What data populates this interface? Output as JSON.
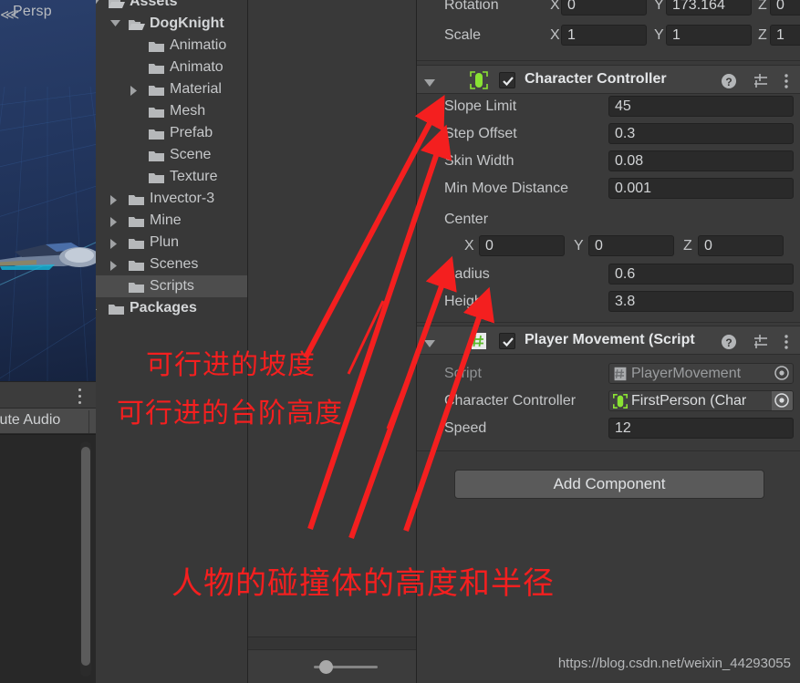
{
  "scene_view": {
    "camera_label": "Persp",
    "persp_icon": "perspective-icon",
    "kebab_icon": "more-options-icon"
  },
  "audio_bar": {
    "mute_audio_label": "lute Audio"
  },
  "project_tree": [
    {
      "label": "Assets",
      "indent": 14,
      "twisty": "down",
      "folder": "folder-open-icon",
      "bold": true,
      "selected": false
    },
    {
      "label": "DogKnight",
      "indent": 36,
      "twisty": "down",
      "folder": "folder-open-icon",
      "bold": true,
      "selected": false
    },
    {
      "label": "Animatio",
      "indent": 58,
      "twisty": "none",
      "folder": "folder-icon",
      "bold": false,
      "selected": false
    },
    {
      "label": "Animato",
      "indent": 58,
      "twisty": "none",
      "folder": "folder-icon",
      "bold": false,
      "selected": false
    },
    {
      "label": "Material",
      "indent": 58,
      "twisty": "right",
      "folder": "folder-icon",
      "bold": false,
      "selected": false
    },
    {
      "label": "Mesh",
      "indent": 58,
      "twisty": "none",
      "folder": "folder-icon",
      "bold": false,
      "selected": false
    },
    {
      "label": "Prefab",
      "indent": 58,
      "twisty": "none",
      "folder": "folder-icon",
      "bold": false,
      "selected": false
    },
    {
      "label": "Scene",
      "indent": 58,
      "twisty": "none",
      "folder": "folder-icon",
      "bold": false,
      "selected": false
    },
    {
      "label": "Texture",
      "indent": 58,
      "twisty": "none",
      "folder": "folder-icon",
      "bold": false,
      "selected": false
    },
    {
      "label": "Invector-3",
      "indent": 36,
      "twisty": "right",
      "folder": "folder-icon",
      "bold": false,
      "selected": false
    },
    {
      "label": "Mine",
      "indent": 36,
      "twisty": "right",
      "folder": "folder-icon",
      "bold": false,
      "selected": false
    },
    {
      "label": "Plun",
      "indent": 36,
      "twisty": "right",
      "folder": "folder-icon",
      "bold": false,
      "selected": false
    },
    {
      "label": "Scenes",
      "indent": 36,
      "twisty": "right",
      "folder": "folder-icon",
      "bold": false,
      "selected": false
    },
    {
      "label": "Scripts",
      "indent": 36,
      "twisty": "none",
      "folder": "folder-icon",
      "bold": false,
      "selected": true
    },
    {
      "label": "Packages",
      "indent": 14,
      "twisty": "right",
      "folder": "folder-icon",
      "bold": true,
      "selected": false
    }
  ],
  "inspector": {
    "transform": {
      "rotation": {
        "label": "Rotation",
        "x_axis": "X",
        "x": "0",
        "y_axis": "Y",
        "y": "173.164",
        "z_axis": "Z",
        "z": "0"
      },
      "scale": {
        "label": "Scale",
        "x_axis": "X",
        "x": "1",
        "y_axis": "Y",
        "y": "1",
        "z_axis": "Z",
        "z": "1"
      }
    },
    "character_controller": {
      "title": "Character Controller",
      "icon": "character-controller-capsule-icon",
      "enabled": true,
      "foldout": "expanded",
      "help_icon": "help-icon",
      "preset_icon": "preset-icon",
      "menu_icon": "more-options-icon",
      "properties": [
        {
          "label": "Slope Limit",
          "value": "45"
        },
        {
          "label": "Step Offset",
          "value": "0.3"
        },
        {
          "label": "Skin Width",
          "value": "0.08"
        },
        {
          "label": "Min Move Distance",
          "value": "0.001"
        }
      ],
      "center": {
        "label": "Center",
        "x_axis": "X",
        "x": "0",
        "y_axis": "Y",
        "y": "0",
        "z_axis": "Z",
        "z": "0"
      },
      "radius": {
        "label": "Radius",
        "value": "0.6"
      },
      "height": {
        "label": "Height",
        "value": "3.8"
      }
    },
    "player_movement": {
      "title": "Player Movement (Script",
      "icon": "cs-script-icon",
      "enabled": true,
      "foldout": "expanded",
      "help_icon": "help-icon",
      "preset_icon": "preset-icon",
      "menu_icon": "more-options-icon",
      "script_row": {
        "label": "Script",
        "value": "PlayerMovement",
        "icon": "cs-script-icon",
        "picker_icon": "object-picker-icon"
      },
      "controller_row": {
        "label": "Character Controller",
        "value": "FirstPerson (Char",
        "icon": "character-controller-capsule-icon",
        "picker_icon": "object-picker-icon"
      },
      "speed_row": {
        "label": "Speed",
        "value": "12"
      }
    },
    "add_component_label": "Add Component"
  },
  "center_panel": {
    "slider_icon": "zoom-slider"
  },
  "annotations": {
    "color": "#f41f1f",
    "note_slope": "可行进的坡度",
    "note_step": "可行进的台阶高度",
    "note_collider": "人物的碰撞体的高度和半径"
  },
  "watermark": {
    "text": "https://blog.csdn.net/weixin_44293055"
  }
}
